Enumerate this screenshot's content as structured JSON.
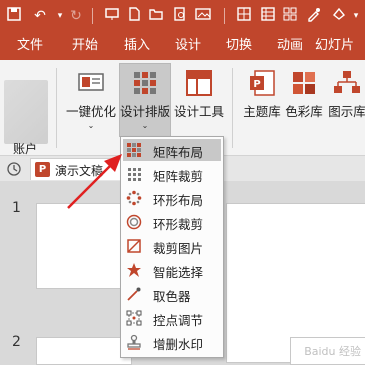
{
  "tabs": [
    "文件",
    "开始",
    "插入",
    "设计",
    "切换",
    "动画",
    "幻灯片"
  ],
  "ribbon": {
    "account_group": "账户",
    "one_click": "一键优化",
    "design_layout": "设计排版",
    "design_tools": "设计工具",
    "theme_lib": "主题库",
    "color_lib": "色彩库",
    "chart_lib": "图示库"
  },
  "document": {
    "tab_title": "演示文稿"
  },
  "slides": [
    "1",
    "2"
  ],
  "menu": {
    "items": [
      "矩阵布局",
      "矩阵裁剪",
      "环形布局",
      "环形裁剪",
      "裁剪图片",
      "智能选择",
      "取色器",
      "控点调节",
      "增删水印"
    ],
    "highlighted_index": 0
  },
  "colors": {
    "accent": "#c0462c",
    "arrow": "#e02020"
  },
  "watermark": "Baidu 经验"
}
